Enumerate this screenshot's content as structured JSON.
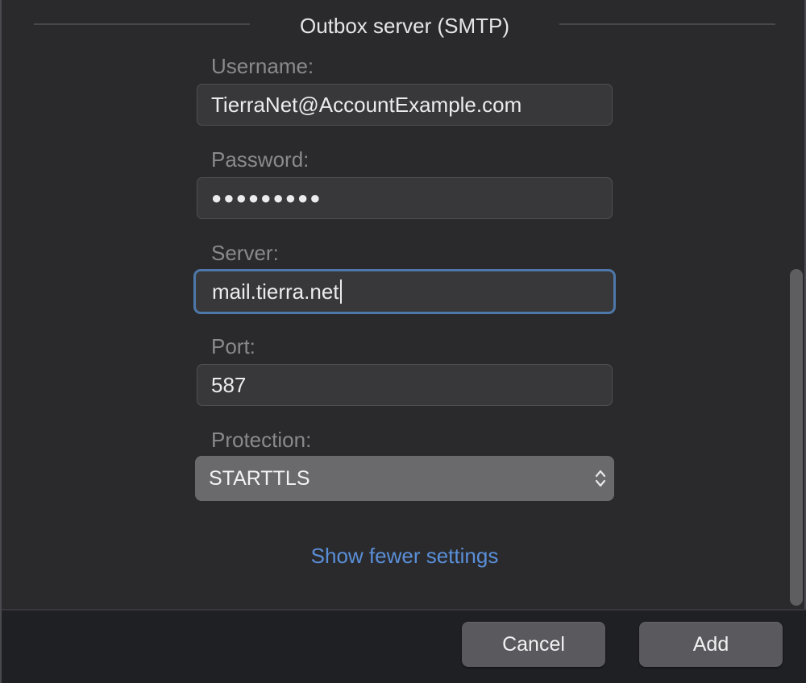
{
  "section": {
    "title": "Outbox server (SMTP)"
  },
  "fields": {
    "username": {
      "label": "Username:",
      "value": "TierraNet@AccountExample.com"
    },
    "password": {
      "label": "Password:",
      "value": "●●●●●●●●●"
    },
    "server": {
      "label": "Server:",
      "value": "mail.tierra.net"
    },
    "port": {
      "label": "Port:",
      "value": "587"
    },
    "protection": {
      "label": "Protection:",
      "value": "STARTTLS"
    }
  },
  "link": {
    "show_fewer": "Show fewer settings"
  },
  "buttons": {
    "cancel": "Cancel",
    "add": "Add"
  },
  "icons": {
    "select_arrows": "chevron-up-down-icon"
  },
  "colors": {
    "accent": "#5a8fd8",
    "focus_ring": "#4d78a9"
  }
}
